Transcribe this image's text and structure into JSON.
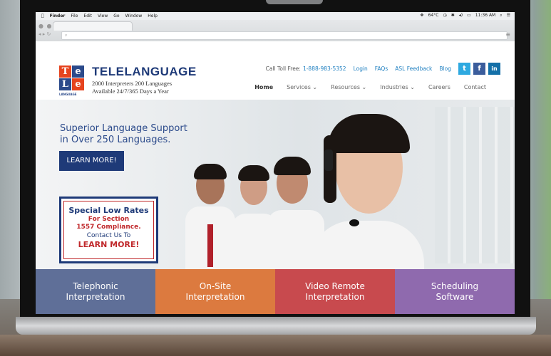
{
  "menubar": {
    "items": [
      "Finder",
      "File",
      "Edit",
      "View",
      "Go",
      "Window",
      "Help"
    ],
    "status": {
      "temp": "64°C",
      "time": "11:36 AM"
    }
  },
  "browser": {
    "address_placeholder": ""
  },
  "header": {
    "logo_letters": [
      "T",
      "e",
      "L",
      "e"
    ],
    "logo_sub": "LANGUAGE",
    "brand": "TELELANGUAGE",
    "tagline1": "2000 Interpreters 200 Languages",
    "tagline2": "Available 24/7/365 Days a Year",
    "call_label": "Call Toll Free:",
    "phone": "1-888-983-5352",
    "links": [
      "Login",
      "FAQs",
      "ASL Feedback",
      "Blog"
    ],
    "social": {
      "twitter": "t",
      "facebook": "f",
      "linkedin": "in"
    },
    "nav": [
      "Home",
      "Services ⌄",
      "Resources ⌄",
      "Industries ⌄",
      "Careers",
      "Contact"
    ]
  },
  "hero": {
    "title_line1": "Superior Language Support",
    "title_line2": "in Over 250 Languages.",
    "cta": "LEARN MORE!",
    "special": {
      "line1": "Special Low Rates",
      "line2": "For Section",
      "line3": "1557 Compliance.",
      "line4": "Contact Us To",
      "line5": "LEARN MORE!"
    }
  },
  "tiles": [
    {
      "line1": "Telephonic",
      "line2": "Interpretation"
    },
    {
      "line1": "On-Site",
      "line2": "Interpretation"
    },
    {
      "line1": "Video Remote",
      "line2": "Interpretation"
    },
    {
      "line1": "Scheduling",
      "line2": "Software"
    }
  ],
  "colors": {
    "navy": "#1e3a78",
    "brand_red": "#e6441f",
    "link_blue": "#1e7fc0",
    "tile1": "#5f6f98",
    "tile2": "#dc7a3f",
    "tile3": "#c84a4e",
    "tile4": "#8f6aae"
  }
}
